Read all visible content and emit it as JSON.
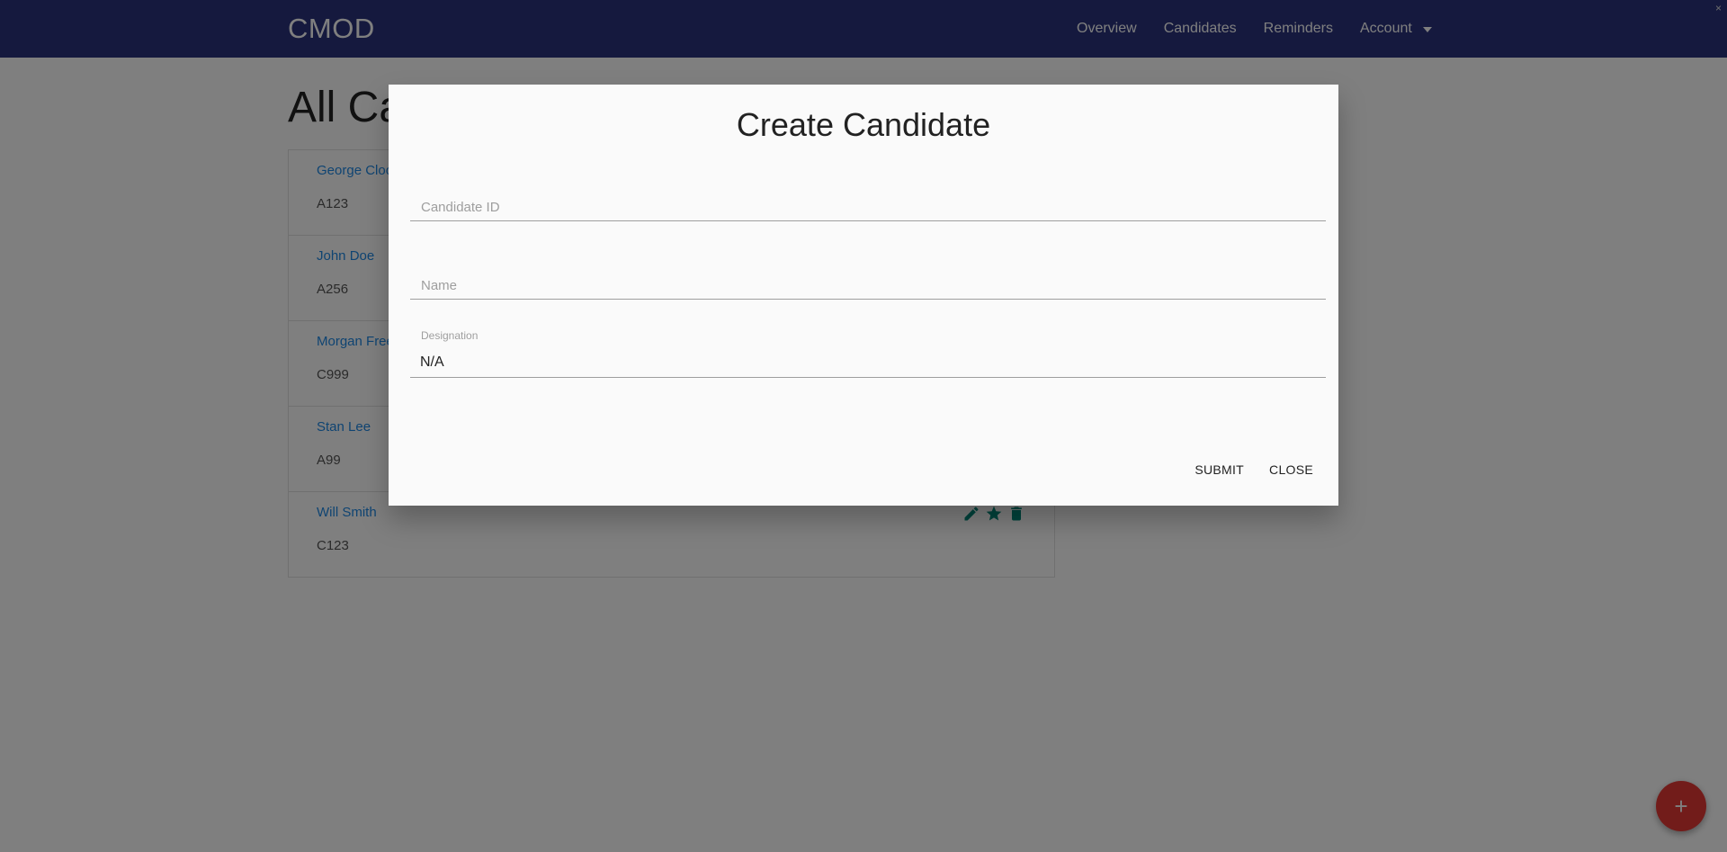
{
  "navbar": {
    "brand": "CMOD",
    "links": [
      "Overview",
      "Candidates",
      "Reminders",
      "Account"
    ],
    "close_glyph": "×"
  },
  "page": {
    "title": "All Candidates"
  },
  "candidates": [
    {
      "name": "George Clooney",
      "id": "A123"
    },
    {
      "name": "John Doe",
      "id": "A256"
    },
    {
      "name": "Morgan Freeman",
      "id": "C999"
    },
    {
      "name": "Stan Lee",
      "id": "A99"
    },
    {
      "name": "Will Smith",
      "id": "C123"
    }
  ],
  "row_action_icons": [
    "edit-icon",
    "star-icon",
    "delete-icon"
  ],
  "modal": {
    "title": "Create Candidate",
    "candidate_id_placeholder": "Candidate ID",
    "name_placeholder": "Name",
    "designation_label": "Designation",
    "designation_value": "N/A",
    "submit_label": "SUBMIT",
    "close_label": "CLOSE"
  },
  "fab": {
    "label": "+",
    "icon": "plus-icon"
  },
  "colors": {
    "navbar": "#2a337c",
    "link": "#1e88e5",
    "action": "#00897b",
    "fab": "#e53935"
  }
}
